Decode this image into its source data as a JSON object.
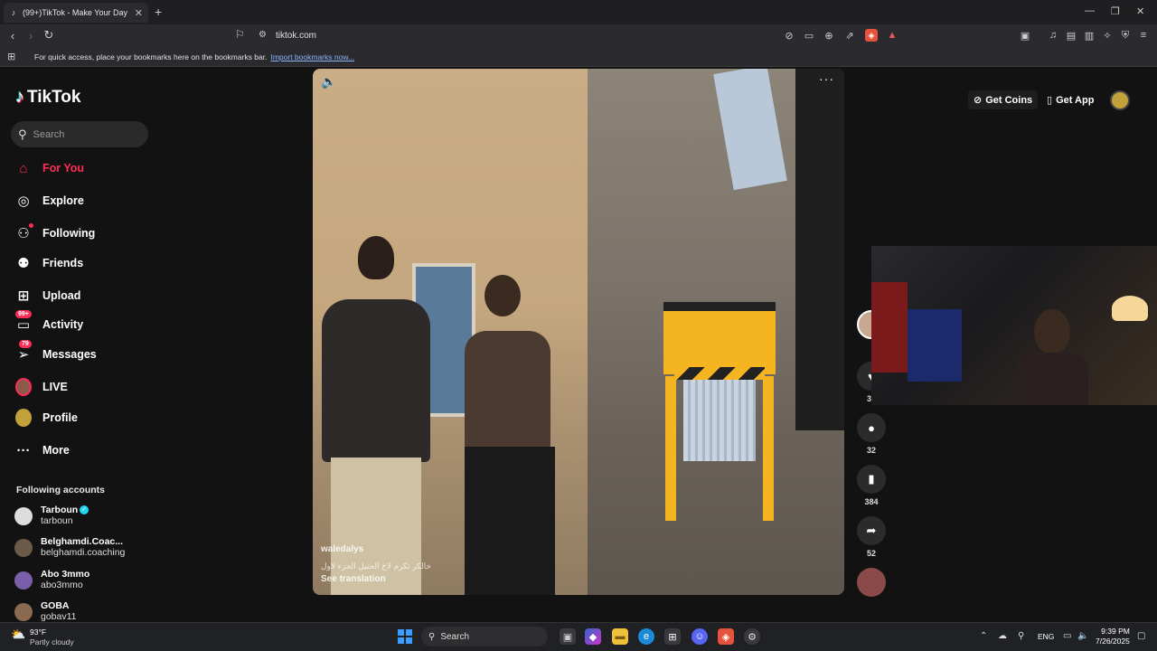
{
  "browser": {
    "tab_title": "(99+)TikTok - Make Your Day",
    "url": "tiktok.com",
    "bookmarks_hint": "For quick access, place your bookmarks here on the bookmarks bar.",
    "bookmarks_import_link": "Import bookmarks now...",
    "brave_badge_count": "9",
    "ext_badge_count": "1"
  },
  "tiktok": {
    "logo_text": "TikTok",
    "search_placeholder": "Search",
    "nav": [
      {
        "label": "For You"
      },
      {
        "label": "Explore"
      },
      {
        "label": "Following"
      },
      {
        "label": "Friends"
      },
      {
        "label": "Upload"
      },
      {
        "label": "Activity",
        "badge": "99+"
      },
      {
        "label": "Messages",
        "badge": "79"
      },
      {
        "label": "LIVE"
      },
      {
        "label": "Profile"
      },
      {
        "label": "More"
      }
    ],
    "following_accounts_title": "Following accounts",
    "following_accounts": [
      {
        "name": "Tarboun",
        "handle": "tarboun",
        "verified": true
      },
      {
        "name": "Belghamdi.Coac...",
        "handle": "belghamdi.coaching"
      },
      {
        "name": "Abo 3mmo",
        "handle": "abo3mmo"
      },
      {
        "name": "GOBA",
        "handle": "gobav11"
      }
    ],
    "header": {
      "get_coins": "Get Coins",
      "get_app": "Get App"
    },
    "video": {
      "author": "waledalys",
      "caption": "خالكر تكرم لاخ الحنيل الجزء لاول",
      "see_translation": "See translation"
    },
    "actions": {
      "likes": "31",
      "comments": "32",
      "saves": "384",
      "shares": "52"
    }
  },
  "taskbar": {
    "weather_temp": "93°F",
    "weather_desc": "Partly cloudy",
    "search_label": "Search",
    "lang": "ENG",
    "time": "9:39 PM",
    "date": "7/26/2025"
  }
}
